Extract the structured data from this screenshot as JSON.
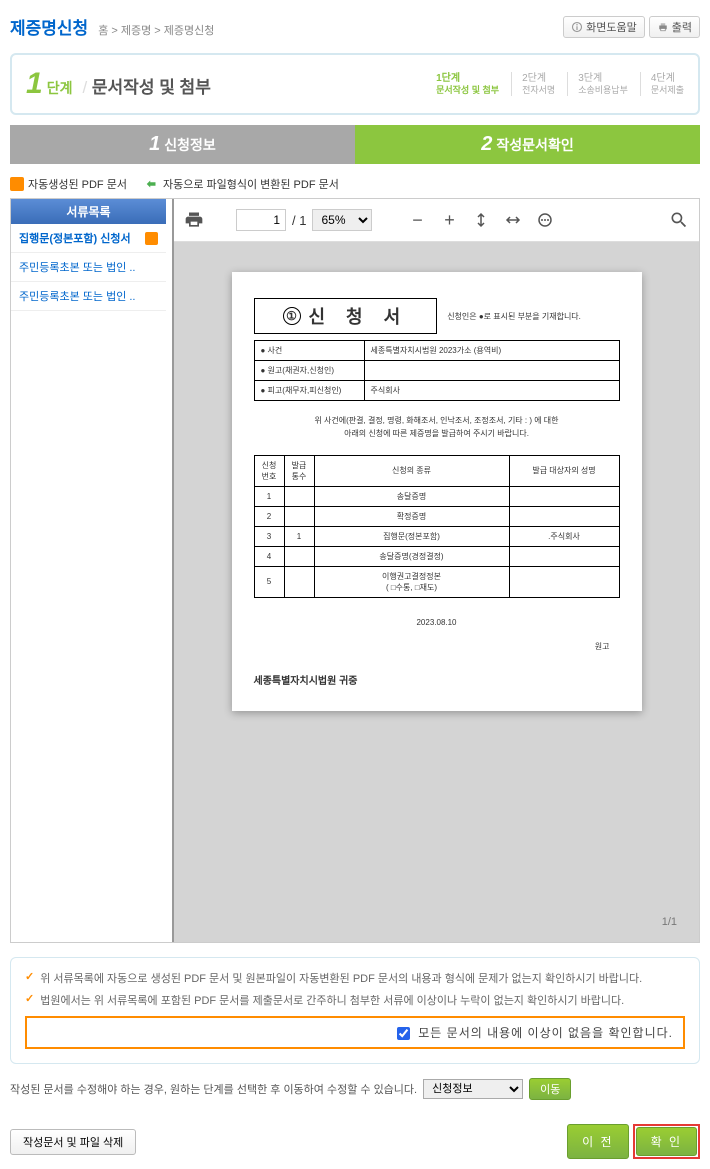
{
  "header": {
    "title": "제증명신청",
    "breadcrumb": "홈 > 제증명 > 제증명신청",
    "help_btn": "화면도움말",
    "print_btn": "출력"
  },
  "step_box": {
    "current_num": "1",
    "current_label": "단계",
    "current_title": "문서작성 및 첨부",
    "steps": [
      {
        "title": "1단계",
        "sub": "문서작성 및 첨부",
        "active": true
      },
      {
        "title": "2단계",
        "sub": "전자서명",
        "active": false
      },
      {
        "title": "3단계",
        "sub": "소송비용납부",
        "active": false
      },
      {
        "title": "4단계",
        "sub": "문서제출",
        "active": false
      }
    ]
  },
  "tabs": [
    {
      "num": "1",
      "label": "신청정보",
      "active": false
    },
    {
      "num": "2",
      "label": "작성문서확인",
      "active": true
    }
  ],
  "legend": {
    "auto_pdf": "자동생성된 PDF 문서",
    "converted_pdf": "자동으로 파일형식이 변환된 PDF 문서"
  },
  "sidebar": {
    "header": "서류목록",
    "items": [
      {
        "label": "집행문(정본포함) 신청서",
        "badge": true,
        "selected": true
      },
      {
        "label": "주민등록초본 또는 법인 ..",
        "badge": false,
        "selected": false
      },
      {
        "label": "주민등록초본 또는 법인 ..",
        "badge": false,
        "selected": false
      }
    ]
  },
  "viewer": {
    "page_current": "1",
    "page_total": "/ 1",
    "zoom": "65%",
    "page_indicator": "1/1"
  },
  "pdf": {
    "title_num": "①",
    "title": "신 청 서",
    "title_note": "신청인은 ●로 표시된 부분을 기재합니다.",
    "info_rows": [
      {
        "label": "● 사건",
        "value": "세종특별자치시법원   2023가소             (용역비)"
      },
      {
        "label": "● 원고(채권자,신청인)",
        "value": ""
      },
      {
        "label": "● 피고(채무자,피신청인)",
        "value": "주식회사"
      }
    ],
    "note_line1": "위 사건에(판결, 결정, 명령, 화해조서, 인낙조서, 조정조서, 기타 :                              ) 에 대한",
    "note_line2": "아래의 신청에 따른 제증명을 발급하여 주시기 바랍니다.",
    "table2_headers": [
      "신청\n번호",
      "발급\n통수",
      "신청의 종류",
      "발급 대상자의 성명"
    ],
    "table2_rows": [
      {
        "num": "1",
        "count": "",
        "type": "송달증명",
        "target": ""
      },
      {
        "num": "2",
        "count": "",
        "type": "확정증명",
        "target": ""
      },
      {
        "num": "3",
        "count": "1",
        "type": "집행문(정본포함)",
        "target": ".주식회사"
      },
      {
        "num": "4",
        "count": "",
        "type": "송달증명(경정결정)",
        "target": ""
      },
      {
        "num": "5",
        "count": "",
        "type": "이행권고결정정본\n( □수통, □재도)",
        "target": ""
      }
    ],
    "date": "2023.08.10",
    "signer": "원고",
    "court": "세종특별자치시법원  귀중"
  },
  "notice": {
    "line1": "위 서류목록에 자동으로 생성된 PDF 문서 및 원본파일이 자동변환된 PDF 문서의 내용과 형식에 문제가 없는지 확인하시기 바랍니다.",
    "line2": "법원에서는 위 서류목록에 포함된 PDF 문서를 제출문서로 간주하니 첨부한 서류에 이상이나 누락이 없는지 확인하시기 바랍니다.",
    "confirm_label": "모든 문서의 내용에 이상이 없음을 확인합니다."
  },
  "goto": {
    "text": "작성된 문서를 수정해야 하는 경우, 원하는 단계를 선택한 후 이동하여 수정할 수 있습니다.",
    "select_value": "신청정보",
    "btn": "이동"
  },
  "bottom": {
    "delete_btn": "작성문서 및 파일 삭제",
    "prev_btn": "이 전",
    "confirm_btn": "확 인"
  }
}
